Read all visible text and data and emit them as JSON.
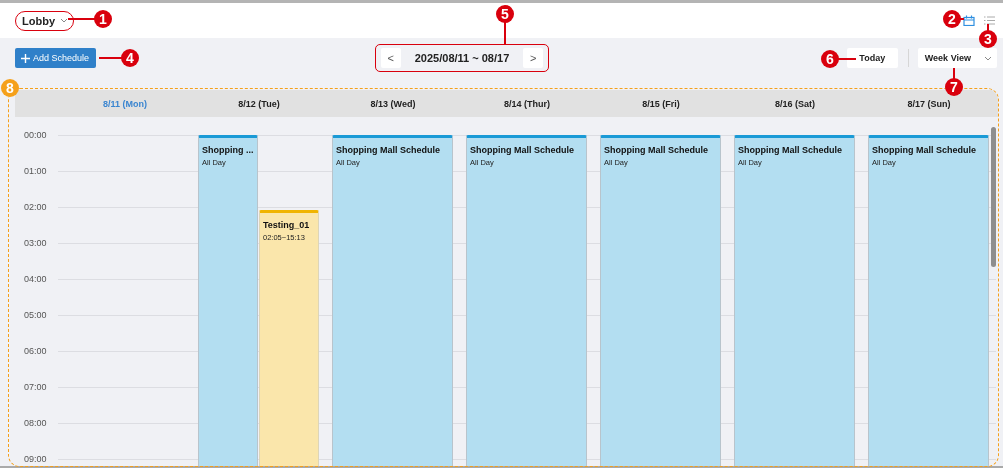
{
  "location": {
    "value": "Lobby"
  },
  "toolbar": {
    "add_button": "Add Schedule",
    "prev": "<",
    "range": "2025/08/11 ~ 08/17",
    "next": ">",
    "today_button": "Today",
    "view": "Week View"
  },
  "calendar": {
    "days": [
      {
        "label": "8/11 (Mon)",
        "today": true
      },
      {
        "label": "8/12 (Tue)",
        "today": false,
        "events": [
          {
            "kind": "all_day",
            "title": "Shopping ...",
            "time": "All Day",
            "color": "#1a9ad6"
          },
          {
            "kind": "timed",
            "title": "Testing_01",
            "time": "02:05~15:13",
            "color": "#f0b400"
          }
        ]
      },
      {
        "label": "8/13 (Wed)",
        "today": false,
        "events": [
          {
            "kind": "all_day",
            "title": "Shopping Mall Schedule",
            "time": "All Day",
            "color": "#1a9ad6"
          }
        ]
      },
      {
        "label": "8/14 (Thur)",
        "today": false,
        "events": [
          {
            "kind": "all_day",
            "title": "Shopping Mall Schedule",
            "time": "All Day",
            "color": "#1a9ad6"
          }
        ]
      },
      {
        "label": "8/15 (Fri)",
        "today": false,
        "events": [
          {
            "kind": "all_day",
            "title": "Shopping Mall Schedule",
            "time": "All Day",
            "color": "#1a9ad6"
          }
        ]
      },
      {
        "label": "8/16 (Sat)",
        "today": false,
        "events": [
          {
            "kind": "all_day",
            "title": "Shopping Mall Schedule",
            "time": "All Day",
            "color": "#1a9ad6"
          }
        ]
      },
      {
        "label": "8/17 (Sun)",
        "today": false,
        "events": [
          {
            "kind": "all_day",
            "title": "Shopping Mall Schedule",
            "time": "All Day",
            "color": "#1a9ad6"
          }
        ]
      }
    ],
    "hours": [
      "00:00",
      "01:00",
      "02:00",
      "03:00",
      "04:00",
      "05:00",
      "06:00",
      "07:00",
      "08:00",
      "09:00"
    ]
  },
  "callouts": [
    {
      "label": "1",
      "color": "#d9000d"
    },
    {
      "label": "2",
      "color": "#d9000d"
    },
    {
      "label": "3",
      "color": "#d9000d"
    },
    {
      "label": "4",
      "color": "#d9000d"
    },
    {
      "label": "5",
      "color": "#d9000d"
    },
    {
      "label": "6",
      "color": "#d9000d"
    },
    {
      "label": "7",
      "color": "#d9000d"
    },
    {
      "label": "8",
      "color": "#f5a01a"
    }
  ]
}
